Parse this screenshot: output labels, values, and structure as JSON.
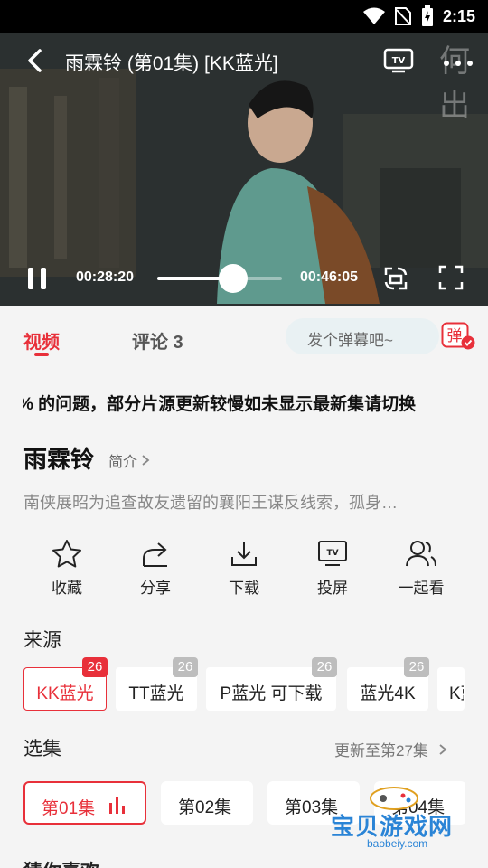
{
  "status_bar": {
    "time": "2:15"
  },
  "player": {
    "title": "雨霖铃 (第01集) [KK蓝光]",
    "watermark": "何出",
    "current_time": "00:28:20",
    "total_time": "00:46:05",
    "progress": 0.61
  },
  "tabs": {
    "video": "视频",
    "comments": "评论 3",
    "danmu_placeholder": "发个弹幕吧~",
    "danmu_button": "弹"
  },
  "notice": "% 的问题，部分片源更新较慢如未显示最新集请切换",
  "drama": {
    "title": "雨霖铃",
    "intro_label": "简介",
    "synopsis": "南侠展昭为追查故友遗留的襄阳王谋反线索，孤身…"
  },
  "actions": [
    {
      "label": "收藏",
      "icon": "star-icon"
    },
    {
      "label": "分享",
      "icon": "share-icon"
    },
    {
      "label": "下载",
      "icon": "download-icon"
    },
    {
      "label": "投屏",
      "icon": "tv-cast-icon"
    },
    {
      "label": "一起看",
      "icon": "watch-together-icon"
    }
  ],
  "source_section": {
    "title": "来源",
    "sources": [
      {
        "label": "KK蓝光",
        "count": "26",
        "active": true
      },
      {
        "label": "TT蓝光",
        "count": "26"
      },
      {
        "label": "P蓝光 可下载",
        "count": "26"
      },
      {
        "label": "蓝光4K",
        "count": "26"
      },
      {
        "label": "K蓝",
        "count": ""
      }
    ]
  },
  "episode_section": {
    "title": "选集",
    "update_text": "更新至第27集",
    "episodes": [
      "第01集",
      "第02集",
      "第03集",
      "第04集"
    ]
  },
  "site_watermark": {
    "name": "宝贝游戏网",
    "url": "baobeiy.com"
  },
  "next_section_title": "猜你喜欢"
}
